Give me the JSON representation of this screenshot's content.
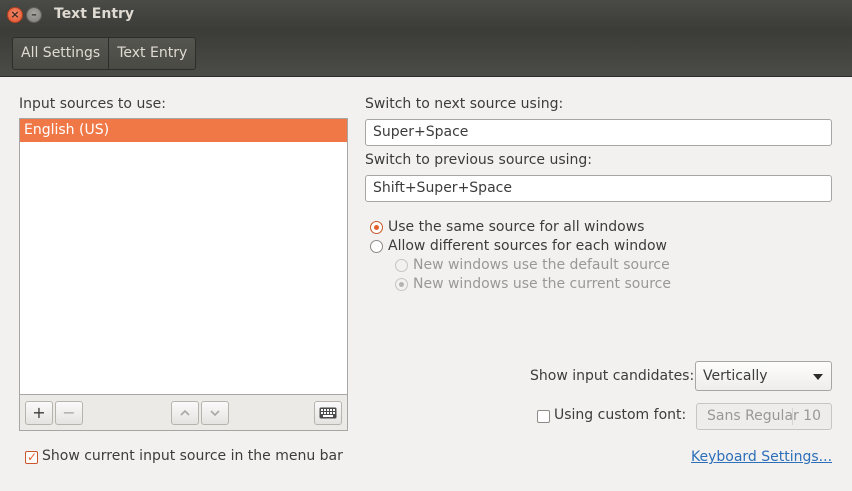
{
  "window": {
    "title": "Text Entry"
  },
  "breadcrumbs": [
    "All Settings",
    "Text Entry"
  ],
  "input_sources": {
    "heading": "Input sources to use:",
    "items": [
      "English (US)"
    ],
    "selected_index": 0,
    "toolbar": {
      "add_glyph": "+",
      "remove_glyph": "−",
      "up_glyph": "⌃",
      "down_glyph": "⌄",
      "keyboard_icon": "keyboard-icon"
    }
  },
  "shortcuts": {
    "next_label": "Switch to next source using:",
    "next_value": "Super+Space",
    "prev_label": "Switch to previous source using:",
    "prev_value": "Shift+Super+Space"
  },
  "source_mode": {
    "same_label": "Use the same source for all windows",
    "different_label": "Allow different sources for each window",
    "default_label": "New windows use the default source",
    "current_label": "New windows use the current source",
    "selected": "same"
  },
  "candidates": {
    "label": "Show input candidates:",
    "value": "Vertically"
  },
  "custom_font": {
    "label": "Using custom font:",
    "checked": false,
    "font_name": "Sans Regular",
    "font_size": "10"
  },
  "menu_bar": {
    "label": "Show current input source in the menu bar",
    "checked": true
  },
  "keyboard_settings_link": "Keyboard Settings...",
  "colors": {
    "accent": "#f07746",
    "titlebar": "#3c3b37",
    "link": "#2d6fb8"
  }
}
